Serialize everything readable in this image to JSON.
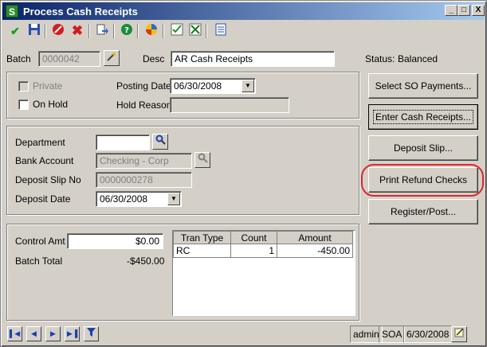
{
  "window": {
    "title": "Process Cash Receipts",
    "app_icon_letter": "S",
    "controls": {
      "minimize": "_",
      "maximize": "□",
      "close": "X"
    }
  },
  "toolbar": {
    "icons": [
      "accept-icon",
      "save-icon",
      "delete-icon",
      "cancel-icon",
      "export-icon",
      "help-icon",
      "options-icon",
      "customizer-icon",
      "user-defined-icon",
      "notes-icon"
    ]
  },
  "header": {
    "batch_label": "Batch",
    "batch_value": "0000042",
    "desc_label": "Desc",
    "desc_value": "AR Cash Receipts",
    "status_label": "Status:",
    "status_value": "Balanced"
  },
  "batch_info": {
    "private_label": "Private",
    "on_hold_label": "On Hold",
    "posting_date_label": "Posting Date",
    "posting_date_value": "06/30/2008",
    "hold_reason_label": "Hold Reason",
    "hold_reason_value": ""
  },
  "deposit": {
    "department_label": "Department",
    "department_value": "",
    "bank_account_label": "Bank Account",
    "bank_account_value": "Checking - Corp",
    "deposit_slip_no_label": "Deposit Slip No",
    "deposit_slip_no_value": "0000000278",
    "deposit_date_label": "Deposit Date",
    "deposit_date_value": "06/30/2008"
  },
  "totals": {
    "control_amt_label": "Control Amt",
    "control_amt_value": "$0.00",
    "batch_total_label": "Batch Total",
    "batch_total_value": "-$450.00"
  },
  "grid": {
    "headers": [
      "Tran Type",
      "Count",
      "Amount"
    ],
    "rows": [
      {
        "tran_type": "RC",
        "count": "1",
        "amount": "-450.00"
      }
    ]
  },
  "actions": {
    "select_so_payments": "Select SO Payments...",
    "enter_cash_receipts": "Enter Cash Receipts...",
    "deposit_slip": "Deposit Slip...",
    "print_refund_checks": "Print Refund Checks",
    "register_post": "Register/Post..."
  },
  "statusbar": {
    "user": "admin",
    "company": "SOA",
    "date": "6/30/2008"
  },
  "colors": {
    "title_start": "#0a246a",
    "highlight": "#e0262a",
    "face": "#d4d0c8"
  }
}
